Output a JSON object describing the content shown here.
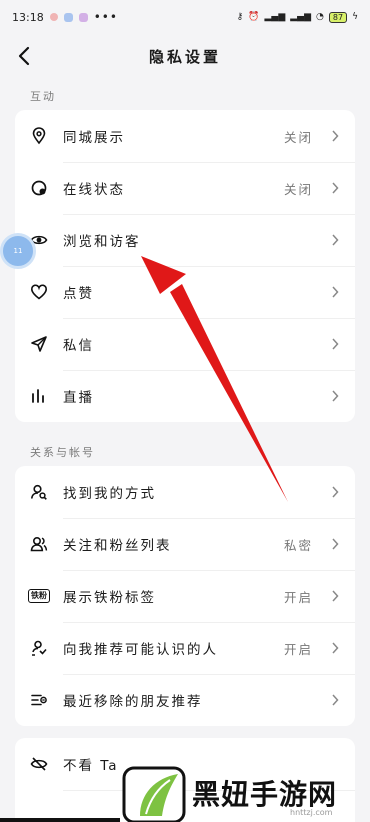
{
  "status": {
    "time": "13:18",
    "battery": "87"
  },
  "header": {
    "title": "隐私设置"
  },
  "sections": {
    "interaction": {
      "label": "互动",
      "items": [
        {
          "label": "同城展示",
          "value": "关闭",
          "icon": "location-pin-icon"
        },
        {
          "label": "在线状态",
          "value": "关闭",
          "icon": "online-status-icon"
        },
        {
          "label": "浏览和访客",
          "value": "",
          "icon": "eye-icon"
        },
        {
          "label": "点赞",
          "value": "",
          "icon": "heart-icon"
        },
        {
          "label": "私信",
          "value": "",
          "icon": "send-message-icon"
        },
        {
          "label": "直播",
          "value": "",
          "icon": "live-bars-icon"
        }
      ]
    },
    "relations": {
      "label": "关系与帐号",
      "items": [
        {
          "label": "找到我的方式",
          "value": "",
          "icon": "user-search-icon"
        },
        {
          "label": "关注和粉丝列表",
          "value": "私密",
          "icon": "users-icon"
        },
        {
          "label": "展示铁粉标签",
          "value": "开启",
          "icon": "fan-badge-icon",
          "badge": "铁粉"
        },
        {
          "label": "向我推荐可能认识的人",
          "value": "开启",
          "icon": "recommend-user-icon"
        },
        {
          "label": "最近移除的朋友推荐",
          "value": "",
          "icon": "removed-list-icon"
        }
      ]
    },
    "more": {
      "items": [
        {
          "label": "不看 Ta",
          "value": "",
          "icon": "hide-eye-icon"
        }
      ]
    }
  },
  "floating": {
    "text": "11"
  },
  "watermark": {
    "text": "黑妞手游网",
    "url": "hnttzj.com"
  }
}
